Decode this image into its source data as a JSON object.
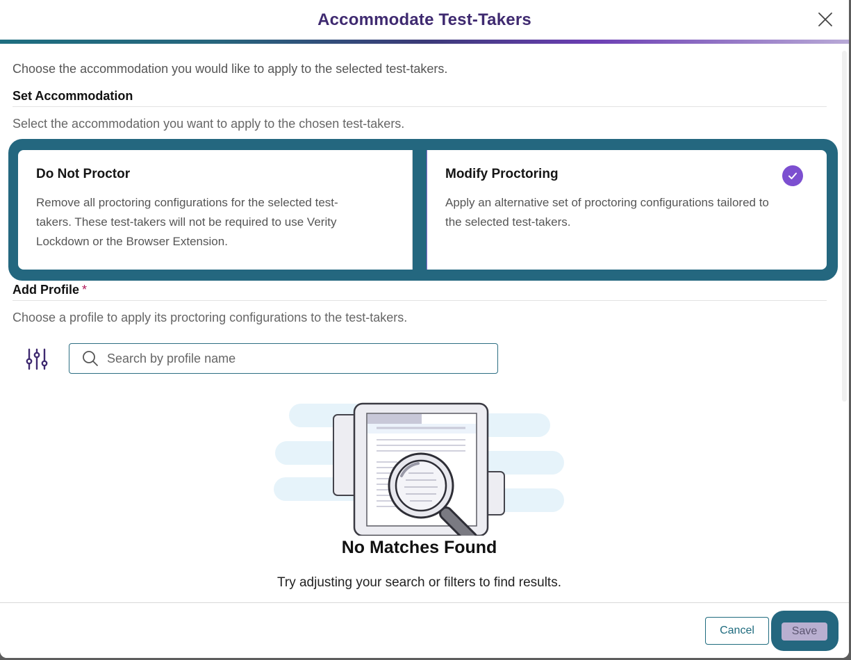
{
  "modal": {
    "title": "Accommodate Test-Takers",
    "intro": "Choose the accommodation you would like to apply to the selected test-takers."
  },
  "set_accommodation": {
    "heading": "Set Accommodation",
    "helper": "Select the accommodation you want to apply to the chosen test-takers.",
    "options": [
      {
        "title": "Do Not Proctor",
        "description": "Remove all proctoring configurations for the selected test-takers. These test-takers will not be required to use Verity Lockdown or the Browser Extension.",
        "selected": false
      },
      {
        "title": "Modify Proctoring",
        "description": "Apply an alternative set of proctoring configurations tailored to the selected test-takers.",
        "selected": true
      }
    ]
  },
  "add_profile": {
    "heading": "Add Profile",
    "required_mark": "*",
    "helper": "Choose a profile to apply its proctoring configurations to the test-takers.",
    "search_placeholder": "Search by profile name",
    "search_value": ""
  },
  "empty_state": {
    "title": "No Matches Found",
    "subtitle": "Try adjusting your search or filters to find results."
  },
  "footer": {
    "cancel_label": "Cancel",
    "save_label": "Save"
  },
  "colors": {
    "title": "#3f2a70",
    "accent_teal": "#1e6b7e",
    "accent_purple": "#7c4fd0",
    "focus_ring": "#24677f",
    "required": "#b0185a"
  },
  "icons": [
    "close-icon",
    "check-icon",
    "filter-sliders-icon",
    "search-icon",
    "magnifier-illustration-icon"
  ]
}
